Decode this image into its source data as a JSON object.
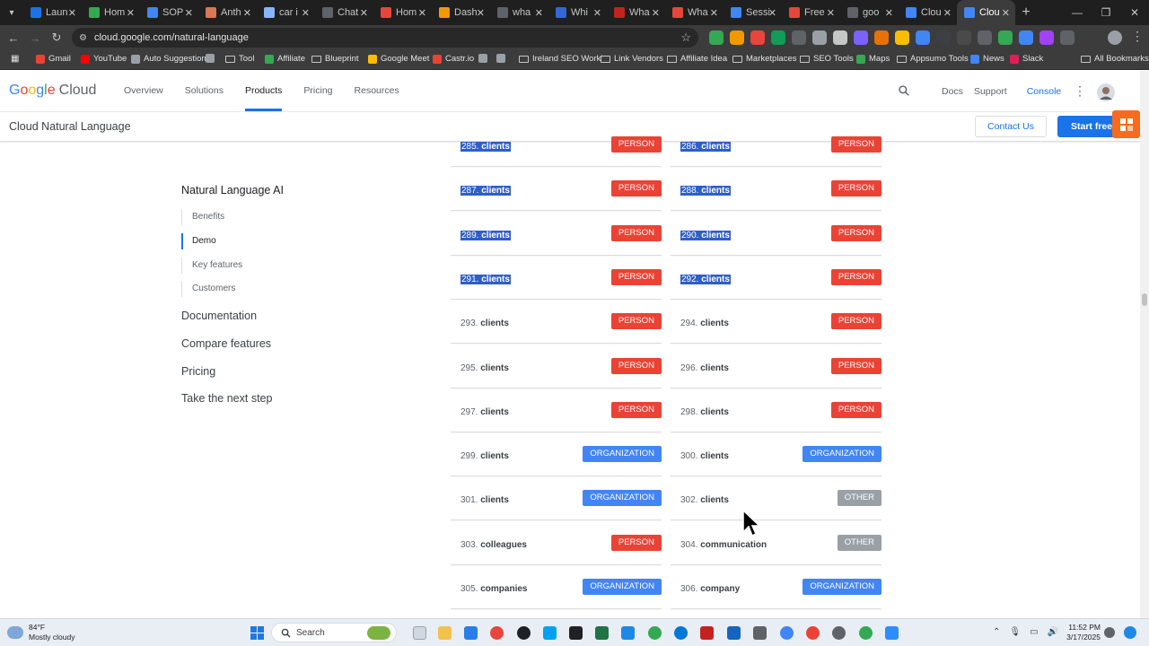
{
  "browser": {
    "tabs": [
      {
        "title": "Laun",
        "fav": "#1a73e8",
        "glyph": ""
      },
      {
        "title": "Hom",
        "fav": "#34a853",
        "glyph": ""
      },
      {
        "title": "SOP",
        "fav": "#4285f4",
        "glyph": ""
      },
      {
        "title": "Anth",
        "fav": "#d97757",
        "glyph": ""
      },
      {
        "title": "car i",
        "fav": "#8ab4f8",
        "glyph": ""
      },
      {
        "title": "Chat",
        "fav": "#5f6368",
        "glyph": ""
      },
      {
        "title": "Hom",
        "fav": "#e8453c",
        "glyph": ""
      },
      {
        "title": "Dash",
        "fav": "#f29900",
        "glyph": ""
      },
      {
        "title": "wha",
        "fav": "#5f6368",
        "glyph": ""
      },
      {
        "title": "Whi",
        "fav": "#3367d6",
        "glyph": ""
      },
      {
        "title": "Wha",
        "fav": "#c5221f",
        "glyph": ""
      },
      {
        "title": "Wha",
        "fav": "#e8453c",
        "glyph": ""
      },
      {
        "title": "Sessi",
        "fav": "#4285f4",
        "glyph": ""
      },
      {
        "title": "Free",
        "fav": "#e8453c",
        "glyph": ""
      },
      {
        "title": "goo",
        "fav": "#5f6368",
        "glyph": ""
      },
      {
        "title": "Clou",
        "fav": "#4285f4",
        "glyph": ""
      },
      {
        "title": "Clou",
        "fav": "#4285f4",
        "glyph": ""
      }
    ],
    "active_tab_index": 16,
    "url": "cloud.google.com/natural-language",
    "bookmarks": [
      {
        "label": "Gmail",
        "color": "#ea4335"
      },
      {
        "label": "YouTube",
        "color": "#ff0000"
      },
      {
        "label": "Auto Suggestion",
        "color": "#9aa0a6"
      },
      {
        "label": "",
        "color": "#9aa0a6"
      },
      {
        "label": "Tool",
        "folder": true
      },
      {
        "label": "Affiliate",
        "color": "#34a853"
      },
      {
        "label": "Blueprint",
        "folder": true
      },
      {
        "label": "Google Meet",
        "color": "#fbbc04"
      },
      {
        "label": "Castr.io",
        "color": "#ea4335"
      },
      {
        "label": "",
        "color": "#9aa0a6"
      },
      {
        "label": "",
        "color": "#9aa0a6"
      },
      {
        "label": "Ireland SEO Work'",
        "folder": true
      },
      {
        "label": "Link Vendors",
        "folder": true
      },
      {
        "label": "Affiliate Idea",
        "folder": true
      },
      {
        "label": "Marketplaces",
        "folder": true
      },
      {
        "label": "SEO Tools",
        "folder": true
      },
      {
        "label": "Maps",
        "color": "#34a853"
      },
      {
        "label": "Appsumo Tools",
        "folder": true
      },
      {
        "label": "News",
        "color": "#4285f4"
      },
      {
        "label": "Slack",
        "color": "#e01e5a"
      },
      {
        "label": "All Bookmarks",
        "folder": true
      }
    ]
  },
  "gc": {
    "logo_google": [
      "G",
      "o",
      "o",
      "g",
      "l",
      "e"
    ],
    "logo_cloud": "Cloud",
    "nav": [
      "Overview",
      "Solutions",
      "Products",
      "Pricing",
      "Resources"
    ],
    "nav_active": "Products",
    "docs": "Docs",
    "support": "Support",
    "console": "Console",
    "page_title": "Cloud Natural Language",
    "contact_us": "Contact Us",
    "start_free": "Start free"
  },
  "leftnav": {
    "title": "Natural Language AI",
    "subitems": [
      "Benefits",
      "Demo",
      "Key features",
      "Customers"
    ],
    "active_sub": "Demo",
    "main": [
      "Documentation",
      "Compare features",
      "Pricing",
      "Take the next step"
    ]
  },
  "entities": [
    {
      "n": "285.",
      "word": "clients",
      "type": "PERSON",
      "sel": true
    },
    {
      "n": "286.",
      "word": "clients",
      "type": "PERSON",
      "sel": true
    },
    {
      "n": "287.",
      "word": "clients",
      "type": "PERSON",
      "sel": true
    },
    {
      "n": "288.",
      "word": "clients",
      "type": "PERSON",
      "sel": true
    },
    {
      "n": "289.",
      "word": "clients",
      "type": "PERSON",
      "sel": true
    },
    {
      "n": "290.",
      "word": "clients",
      "type": "PERSON",
      "sel": true
    },
    {
      "n": "291.",
      "word": "clients",
      "type": "PERSON",
      "sel": true
    },
    {
      "n": "292.",
      "word": "clients",
      "type": "PERSON",
      "sel": true
    },
    {
      "n": "293.",
      "word": "clients",
      "type": "PERSON",
      "sel": false
    },
    {
      "n": "294.",
      "word": "clients",
      "type": "PERSON",
      "sel": false
    },
    {
      "n": "295.",
      "word": "clients",
      "type": "PERSON",
      "sel": false
    },
    {
      "n": "296.",
      "word": "clients",
      "type": "PERSON",
      "sel": false
    },
    {
      "n": "297.",
      "word": "clients",
      "type": "PERSON",
      "sel": false
    },
    {
      "n": "298.",
      "word": "clients",
      "type": "PERSON",
      "sel": false
    },
    {
      "n": "299.",
      "word": "clients",
      "type": "ORGANIZATION",
      "sel": false
    },
    {
      "n": "300.",
      "word": "clients",
      "type": "ORGANIZATION",
      "sel": false
    },
    {
      "n": "301.",
      "word": "clients",
      "type": "ORGANIZATION",
      "sel": false
    },
    {
      "n": "302.",
      "word": "clients",
      "type": "OTHER",
      "sel": false
    },
    {
      "n": "303.",
      "word": "colleagues",
      "type": "PERSON",
      "sel": false
    },
    {
      "n": "304.",
      "word": "communication",
      "type": "OTHER",
      "sel": false
    },
    {
      "n": "305.",
      "word": "companies",
      "type": "ORGANIZATION",
      "sel": false
    },
    {
      "n": "306.",
      "word": "company",
      "type": "ORGANIZATION",
      "sel": false
    }
  ],
  "taskbar": {
    "temp": "84°F",
    "weather": "Mostly cloudy",
    "search": "Search",
    "time": "11:52 PM",
    "date": "3/17/2025"
  }
}
